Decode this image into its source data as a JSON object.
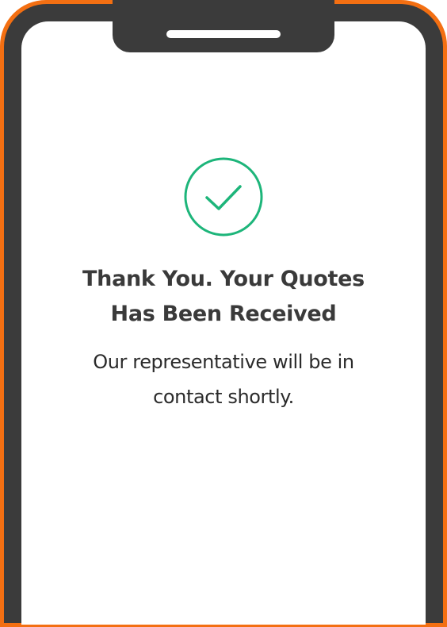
{
  "confirmation": {
    "icon": "check-circle-icon",
    "title_line1": "Thank You. Your Quotes",
    "title_line2": "Has Been Received",
    "message_line1": "Our representative will be in",
    "message_line2": "contact shortly."
  },
  "colors": {
    "phone_accent": "#f36f12",
    "phone_frame": "#3b3b3b",
    "success": "#1db57a",
    "text_dark": "#3a3a3a"
  }
}
